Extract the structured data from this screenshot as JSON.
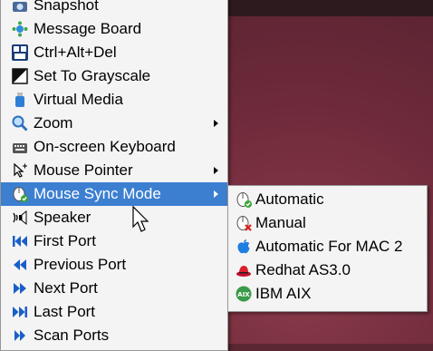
{
  "menu": {
    "items": [
      {
        "label": "Snapshot",
        "icon": "camera-icon"
      },
      {
        "label": "Message Board",
        "icon": "message-board-icon"
      },
      {
        "label": "Ctrl+Alt+Del",
        "icon": "ctrl-alt-del-icon"
      },
      {
        "label": "Set To Grayscale",
        "icon": "grayscale-icon"
      },
      {
        "label": "Virtual Media",
        "icon": "usb-drive-icon"
      },
      {
        "label": "Zoom",
        "icon": "magnifier-icon"
      },
      {
        "label": "On-screen Keyboard",
        "icon": "keyboard-icon"
      },
      {
        "label": "Mouse Pointer",
        "icon": "pointer-icon"
      },
      {
        "label": "Mouse Sync Mode",
        "icon": "mouse-sync-icon"
      },
      {
        "label": "Speaker",
        "icon": "speaker-icon"
      },
      {
        "label": "First Port",
        "icon": "first-port-icon"
      },
      {
        "label": "Previous Port",
        "icon": "previous-port-icon"
      },
      {
        "label": "Next Port",
        "icon": "next-port-icon"
      },
      {
        "label": "Last Port",
        "icon": "last-port-icon"
      },
      {
        "label": "Scan Ports",
        "icon": "scan-ports-icon"
      }
    ]
  },
  "submenu": {
    "items": [
      {
        "label": "Automatic",
        "icon": "auto-mouse-icon"
      },
      {
        "label": "Manual",
        "icon": "manual-mouse-icon"
      },
      {
        "label": "Automatic For MAC 2",
        "icon": "apple-icon"
      },
      {
        "label": "Redhat AS3.0",
        "icon": "redhat-icon"
      },
      {
        "label": "IBM AIX",
        "icon": "aix-icon"
      }
    ]
  },
  "colors": {
    "highlight": "#3c7fd1",
    "menu_bg": "#f4f4f4",
    "desktop": "#6d2a3a"
  }
}
